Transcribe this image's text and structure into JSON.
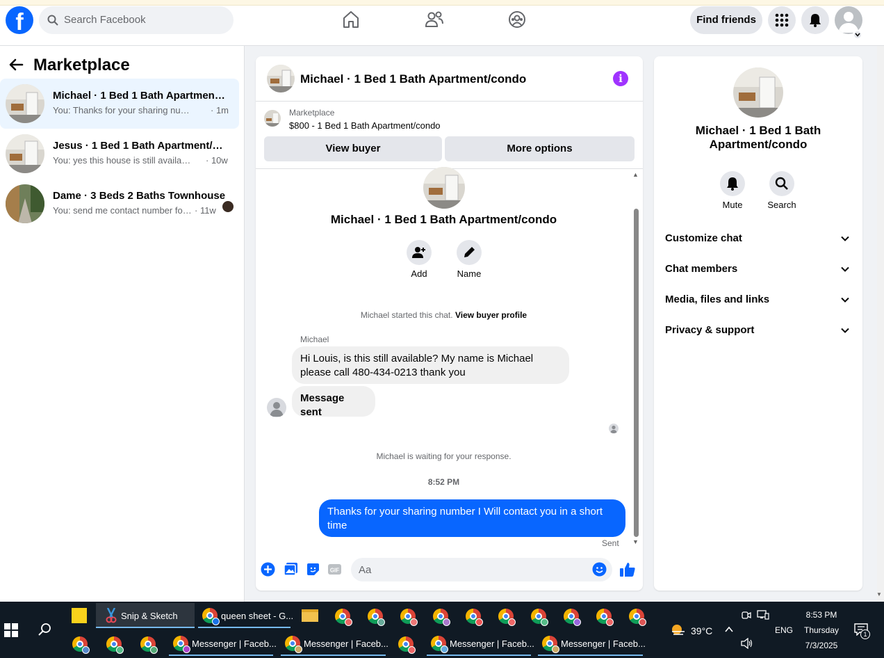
{
  "topbar": {
    "logo": "f",
    "search_placeholder": "Search Facebook",
    "find_friends": "Find friends"
  },
  "left": {
    "title": "Marketplace",
    "conversations": [
      {
        "name": "Michael · 1 Bed 1 Bath Apartment/...",
        "preview": "You: Thanks for your sharing number ...",
        "time": "· 1m"
      },
      {
        "name": "Jesus · 1 Bed 1 Bath Apartment/co...",
        "preview": "You: yes this house is still available f...",
        "time": "· 10w"
      },
      {
        "name": "Dame · 3 Beds 2 Baths Townhouse",
        "preview": "You: send me contact number for...",
        "time": "· 11w"
      }
    ]
  },
  "chat": {
    "header_title": "Michael · 1 Bed 1 Bath Apartment/condo",
    "info_icon": "i",
    "listing_label": "Marketplace",
    "listing_price": "$800 - 1 Bed 1 Bath Apartment/condo",
    "view_buyer": "View buyer",
    "more_options": "More options",
    "intro_title": "Michael · 1 Bed 1 Bath Apartment/condo",
    "add_label": "Add",
    "name_label": "Name",
    "started_text": "Michael started this chat.",
    "view_buyer_profile": "View buyer profile",
    "sender": "Michael",
    "msg1": "Hi Louis, is this still available? My name is Michael please call 480-434-0213 thank you",
    "msg2": "Message sent",
    "waiting": "Michael is waiting for your response.",
    "timestamp": "8:52 PM",
    "my_msg": "Thanks for your sharing number I Will contact you in  a short time",
    "sent": "Sent",
    "composer_placeholder": "Aa"
  },
  "right": {
    "title": "Michael · 1 Bed 1 Bath Apartment/condo",
    "mute": "Mute",
    "search": "Search",
    "rows": [
      "Customize chat",
      "Chat members",
      "Media, files and links",
      "Privacy & support"
    ]
  },
  "taskbar": {
    "snip": "Snip & Sketch",
    "queen": "queen sheet - G...",
    "messenger": "Messenger | Faceb...",
    "temp": "39°C",
    "lang": "ENG",
    "time": "8:53 PM",
    "day": "Thursday",
    "date": "7/3/2025",
    "notif_count": "1"
  },
  "colors": {
    "accent": "#0866ff",
    "info": "#a033ff",
    "taskbar": "#101a24"
  }
}
